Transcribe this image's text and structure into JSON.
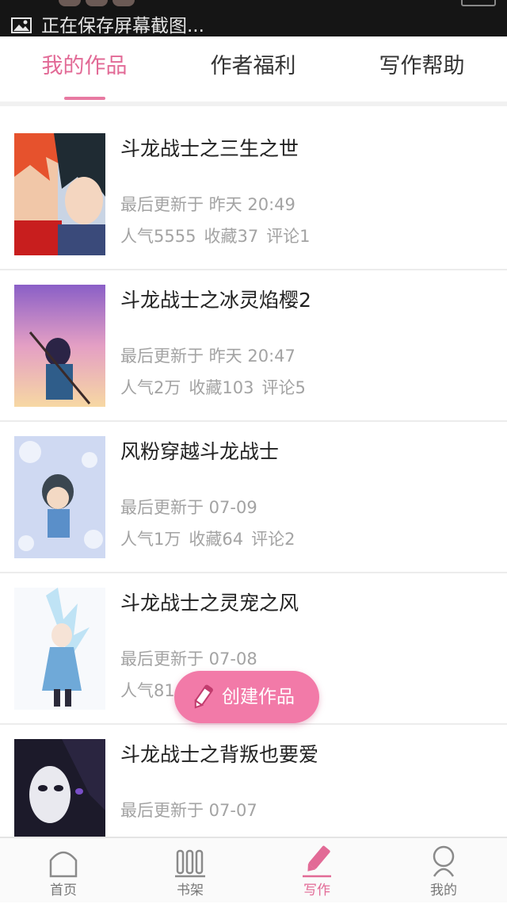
{
  "status_bar": {
    "notification": "正在保存屏幕截图..."
  },
  "tabs": [
    {
      "label": "我的作品",
      "active": true
    },
    {
      "label": "作者福利",
      "active": false
    },
    {
      "label": "写作帮助",
      "active": false
    }
  ],
  "works": [
    {
      "title": "斗龙战士之三生之世",
      "updated": "最后更新于 昨天 20:49",
      "popularity": "人气5555",
      "favorites": "收藏37",
      "comments": "评论1"
    },
    {
      "title": "斗龙战士之冰灵焰樱2",
      "updated": "最后更新于 昨天 20:47",
      "popularity": "人气2万",
      "favorites": "收藏103",
      "comments": "评论5"
    },
    {
      "title": "风粉穿越斗龙战士",
      "updated": "最后更新于 07-09",
      "popularity": "人气1万",
      "favorites": "收藏64",
      "comments": "评论2"
    },
    {
      "title": "斗龙战士之灵宠之风",
      "updated": "最后更新于 07-08",
      "popularity": "人气81",
      "favorites": "",
      "comments": ""
    },
    {
      "title": "斗龙战士之背叛也要爱",
      "updated": "最后更新于 07-07",
      "popularity": "",
      "favorites": "",
      "comments": ""
    }
  ],
  "fab": {
    "label": "创建作品",
    "icon": "pencil-icon"
  },
  "bottom_nav": [
    {
      "label": "首页",
      "icon": "home-icon",
      "active": false
    },
    {
      "label": "书架",
      "icon": "bookshelf-icon",
      "active": false
    },
    {
      "label": "写作",
      "icon": "pencil-icon",
      "active": true
    },
    {
      "label": "我的",
      "icon": "profile-icon",
      "active": false
    }
  ],
  "colors": {
    "accent": "#e26a96",
    "fab": "#f27aa8",
    "text": "#222222",
    "muted": "#a3a3a3"
  }
}
